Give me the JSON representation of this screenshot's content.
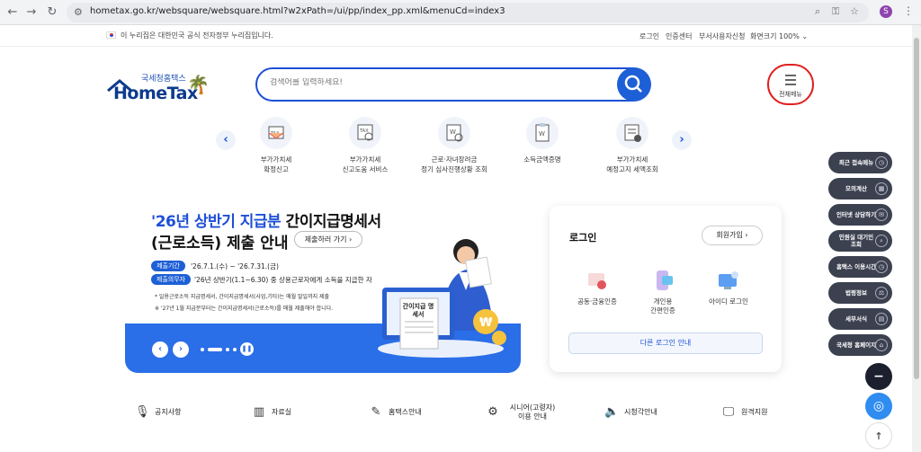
{
  "browser": {
    "url": "hometax.go.kr/websquare/websquare.html?w2xPath=/ui/pp/index_pp.xml&menuCd=index3",
    "profile_initial": "S"
  },
  "notice": {
    "text": "이 누리집은 대한민국 공식 전자정부 누리집입니다.",
    "links": [
      "로그인",
      "인증센터",
      "부서사용자신청",
      "화면크기 100% ⌄"
    ]
  },
  "logo": {
    "small": "국세청홈택스",
    "big": "HomeTax"
  },
  "search": {
    "placeholder": "검색어를 입력하세요!"
  },
  "all_menu": {
    "label": "전체메뉴"
  },
  "quick_menu": [
    {
      "line1": "부가가치세",
      "line2": "확정신고"
    },
    {
      "line1": "부가가치세",
      "line2": "신고도움 서비스"
    },
    {
      "line1": "근로·자녀장려금",
      "line2": "정기 심사진행상황 조회"
    },
    {
      "line1": "소득금액증명",
      "line2": ""
    },
    {
      "line1": "부가가치세",
      "line2": "예정고지 세액조회"
    }
  ],
  "banner": {
    "title_highlight": "'26년 상반기 지급분",
    "title_rest": " 간이지급명세서",
    "title_line2": "(근로소득) 제출 안내",
    "submit_button": "제출하러 가기 ›",
    "period_label": "제출기간",
    "period_value": "'26.7.1.(수) ~ '26.7.31.(금)",
    "obligor_label": "제출의무자",
    "obligor_value": "'26년 상반기(1.1~6.30) 중 상용근로자에게 소득을 지급한 자",
    "note1": "* 일용근로소득 지급명세서, 간이지급명세서(사업,기타)는 매월 말일까지 제출",
    "note2": "※ '27년 1월 지급분부터는 간이지급명세서(근로소득)를 매월 제출해야 합니다.",
    "doc_label": "간이지급 명세서"
  },
  "login": {
    "title": "로그인",
    "join": "회원가입 ›",
    "options": [
      {
        "line1": "공동·금융인증",
        "line2": ""
      },
      {
        "line1": "개인용",
        "line2": "간편인증"
      },
      {
        "line1": "아이디 로그인",
        "line2": ""
      }
    ],
    "other": "다른 로그인 안내"
  },
  "side_menu": [
    {
      "label": "최근 접속메뉴",
      "icon": "clock-icon"
    },
    {
      "label": "모의계산",
      "icon": "calculator-icon"
    },
    {
      "label": "인터넷 상담하기",
      "icon": "chat-icon"
    },
    {
      "label": "민원실 대기인 조회",
      "icon": "search-icon"
    },
    {
      "label": "홈택스 이용시간",
      "icon": "clock-icon"
    },
    {
      "label": "법령정보",
      "icon": "gavel-icon"
    },
    {
      "label": "세무서식",
      "icon": "document-icon"
    },
    {
      "label": "국세청 홈페이지",
      "icon": "home-icon"
    }
  ],
  "bottom_nav": [
    {
      "label": "공지사항",
      "icon": "microphone-icon"
    },
    {
      "label": "자료실",
      "icon": "folder-icon"
    },
    {
      "label": "홈택스안내",
      "icon": "edit-icon"
    },
    {
      "label": "시니어(고령자) 이용 안내",
      "icon": "senior-icon"
    },
    {
      "label": "시청각안내",
      "icon": "speaker-icon"
    },
    {
      "label": "원격지원",
      "icon": "monitor-icon"
    }
  ],
  "colors": {
    "brand_blue": "#1d4fd6",
    "banner_blue": "#2a6ee8",
    "side_dark": "#3c4150",
    "highlight_red": "#e02020"
  }
}
